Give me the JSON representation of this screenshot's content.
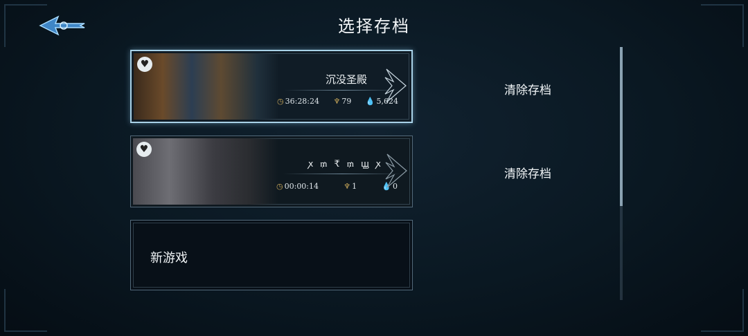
{
  "header": {
    "title": "选择存档"
  },
  "slots": [
    {
      "name": "沉没圣殿",
      "time": "36:28:24",
      "geo": "79",
      "essence": "5,624",
      "selected": true,
      "clear_label": "清除存档"
    },
    {
      "name": "ꭗ ₥ ₹ ₥ ꚗ ꭗ",
      "time": "00:00:14",
      "geo": "1",
      "essence": "0",
      "selected": false,
      "clear_label": "清除存档"
    }
  ],
  "new_game": {
    "label": "新游戏"
  },
  "icons": {
    "back": "back-arrow-icon",
    "heart": "heart-icon",
    "clock": "clock-icon",
    "geo": "geo-currency-icon",
    "essence": "water-drop-icon",
    "wing": "wing-ornament-icon"
  },
  "colors": {
    "accent": "#a9d2e8",
    "gold": "#c9a85a",
    "drop": "#8ec0e0"
  }
}
